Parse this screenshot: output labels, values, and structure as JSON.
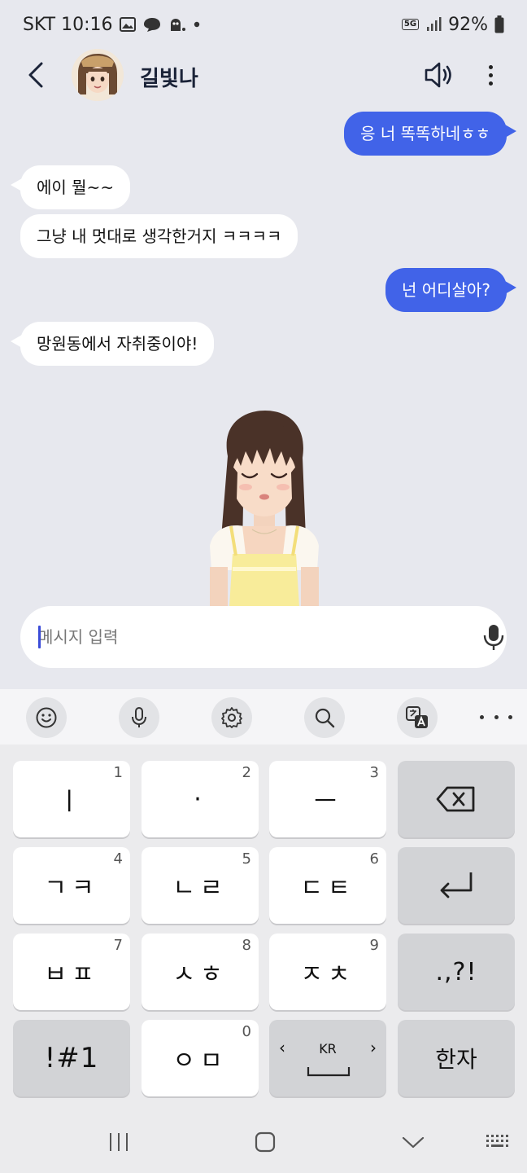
{
  "status_bar": {
    "carrier_time": "SKT 10:16",
    "network": "5G",
    "battery": "92%"
  },
  "header": {
    "contact_name": "길빛나"
  },
  "messages": [
    {
      "from": "me",
      "text": "응 너 똑똑하네ㅎㅎ"
    },
    {
      "from": "bot",
      "text": "에이 뭘~~"
    },
    {
      "from": "bot",
      "text": "그냥 내 멋대로 생각한거지 ㅋㅋㅋㅋ"
    },
    {
      "from": "me",
      "text": "넌 어디살아?"
    },
    {
      "from": "bot",
      "text": "망원동에서 자취중이야!"
    }
  ],
  "input": {
    "placeholder": "메시지 입력"
  },
  "keyboard": {
    "rows": [
      [
        {
          "label": "ㅣ",
          "num": "1"
        },
        {
          "label": "·",
          "num": "2"
        },
        {
          "label": "ㅡ",
          "num": "3"
        },
        {
          "label": "backspace-icon"
        }
      ],
      [
        {
          "label": "ㄱㅋ",
          "num": "4"
        },
        {
          "label": "ㄴㄹ",
          "num": "5"
        },
        {
          "label": "ㄷㅌ",
          "num": "6"
        },
        {
          "label": "enter-icon"
        }
      ],
      [
        {
          "label": "ㅂㅍ",
          "num": "7"
        },
        {
          "label": "ㅅㅎ",
          "num": "8"
        },
        {
          "label": "ㅈㅊ",
          "num": "9"
        },
        {
          "label": ".,?!"
        }
      ],
      [
        {
          "label": "!#1"
        },
        {
          "label": "ㅇㅁ",
          "num": "0"
        },
        {
          "label": "KR"
        },
        {
          "label": "한자"
        }
      ]
    ]
  },
  "colors": {
    "accent": "#4163e8",
    "background": "#e7e8ee"
  }
}
